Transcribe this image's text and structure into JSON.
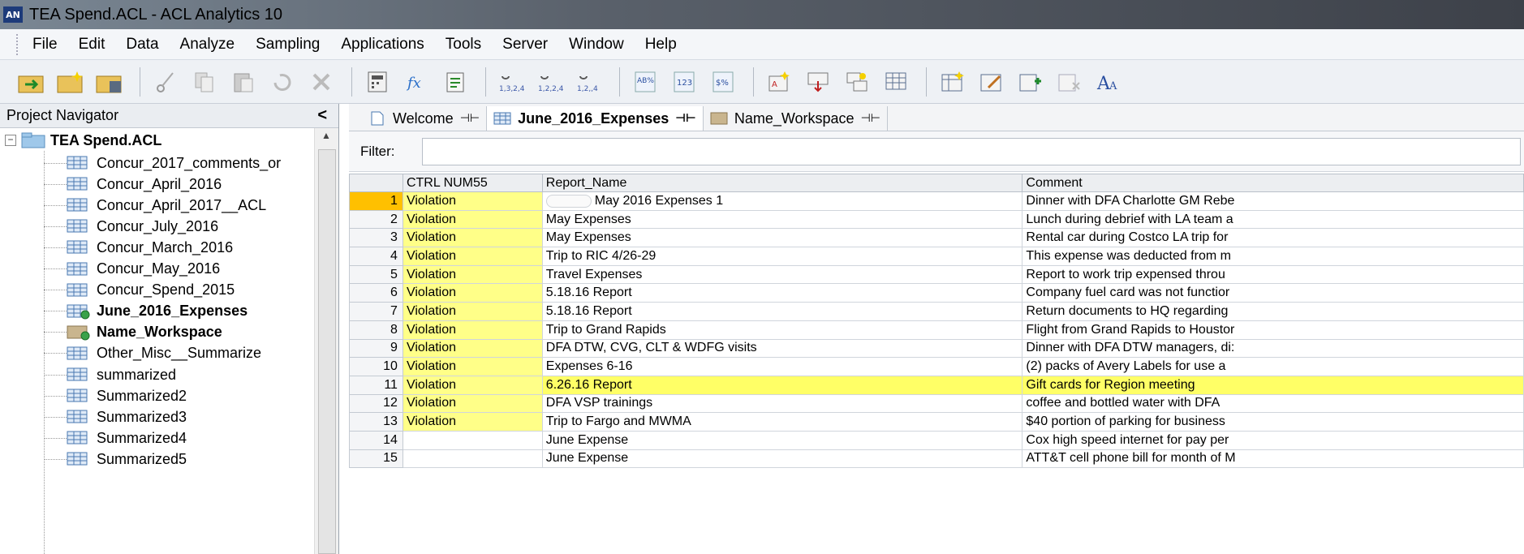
{
  "window": {
    "title": "TEA Spend.ACL - ACL Analytics 10",
    "logo": "AN"
  },
  "menu": [
    "File",
    "Edit",
    "Data",
    "Analyze",
    "Sampling",
    "Applications",
    "Tools",
    "Server",
    "Window",
    "Help"
  ],
  "toolbar_icons": [
    "open-project-icon",
    "new-project-icon",
    "save-project-icon",
    "cut-icon",
    "copy-icon",
    "paste-icon",
    "undo-icon",
    "delete-icon",
    "calculator-icon",
    "function-icon",
    "clipboard-icon",
    "sort-ascending-icon",
    "sort-quick-icon",
    "sort-descending-icon",
    "format-icon",
    "number-format-icon",
    "currency-format-icon",
    "add-field-icon",
    "filter-table-icon",
    "relation-icon",
    "table-layout-icon",
    "add-table-icon",
    "edit-table-icon",
    "add-column-icon",
    "remove-column-icon",
    "font-icon"
  ],
  "navigator": {
    "title": "Project Navigator",
    "collapse_glyph": "<",
    "root": {
      "expander": "−",
      "label": "TEA Spend.ACL"
    },
    "items": [
      {
        "label": "Concur_2017_comments_or",
        "bold": false,
        "type": "table"
      },
      {
        "label": "Concur_April_2016",
        "bold": false,
        "type": "table"
      },
      {
        "label": "Concur_April_2017__ACL",
        "bold": false,
        "type": "table"
      },
      {
        "label": "Concur_July_2016",
        "bold": false,
        "type": "table"
      },
      {
        "label": "Concur_March_2016",
        "bold": false,
        "type": "table"
      },
      {
        "label": "Concur_May_2016",
        "bold": false,
        "type": "table"
      },
      {
        "label": "Concur_Spend_2015",
        "bold": false,
        "type": "table"
      },
      {
        "label": "June_2016_Expenses",
        "bold": true,
        "type": "table-open"
      },
      {
        "label": "Name_Workspace",
        "bold": true,
        "type": "workspace-open"
      },
      {
        "label": "Other_Misc__Summarize",
        "bold": false,
        "type": "table"
      },
      {
        "label": "summarized",
        "bold": false,
        "type": "table"
      },
      {
        "label": "Summarized2",
        "bold": false,
        "type": "table"
      },
      {
        "label": "Summarized3",
        "bold": false,
        "type": "table"
      },
      {
        "label": "Summarized4",
        "bold": false,
        "type": "table"
      },
      {
        "label": "Summarized5",
        "bold": false,
        "type": "table"
      }
    ]
  },
  "tabs": [
    {
      "label": "Welcome",
      "icon": "page-icon",
      "active": false
    },
    {
      "label": "June_2016_Expenses",
      "icon": "table-icon",
      "active": true
    },
    {
      "label": "Name_Workspace",
      "icon": "workspace-icon",
      "active": false
    }
  ],
  "filter": {
    "label": "Filter:",
    "value": ""
  },
  "grid": {
    "columns": [
      "CTRL NUM55",
      "Report_Name",
      "Comment"
    ],
    "selected_row": 1,
    "highlight_color": "#ffff88",
    "rows": [
      {
        "n": "1",
        "ctrl": "Violation",
        "report": "May 2016 Expenses 1",
        "comment": "Dinner with DFA Charlotte GM Rebe",
        "redacted": true
      },
      {
        "n": "2",
        "ctrl": "Violation",
        "report": "May Expenses",
        "comment": "Lunch during debrief with LA team a"
      },
      {
        "n": "3",
        "ctrl": "Violation",
        "report": "May Expenses",
        "comment": "Rental car during Costco LA trip for"
      },
      {
        "n": "4",
        "ctrl": "Violation",
        "report": "Trip to RIC 4/26-29",
        "comment": "This expense was deducted from m"
      },
      {
        "n": "5",
        "ctrl": "Violation",
        "report": "Travel Expenses",
        "comment": "Report to work trip expensed throu"
      },
      {
        "n": "6",
        "ctrl": "Violation",
        "report": "5.18.16 Report",
        "comment": "Company fuel card was not functior"
      },
      {
        "n": "7",
        "ctrl": "Violation",
        "report": "5.18.16 Report",
        "comment": "Return documents to HQ regarding"
      },
      {
        "n": "8",
        "ctrl": "Violation",
        "report": "Trip to Grand Rapids",
        "comment": "Flight from Grand Rapids to Houstor"
      },
      {
        "n": "9",
        "ctrl": "Violation",
        "report": "DFA DTW, CVG, CLT & WDFG visits",
        "comment": "Dinner with DFA DTW managers, di:"
      },
      {
        "n": "10",
        "ctrl": "Violation",
        "report": "Expenses 6-16",
        "comment": "(2) packs of Avery Labels for use a"
      },
      {
        "n": "11",
        "ctrl": "Violation",
        "report": "6.26.16 Report",
        "comment": "Gift cards for Region meeting",
        "highlight_row": true
      },
      {
        "n": "12",
        "ctrl": "Violation",
        "report": "DFA VSP trainings",
        "comment": "coffee and bottled water with DFA"
      },
      {
        "n": "13",
        "ctrl": "Violation",
        "report": "Trip to Fargo and MWMA",
        "comment": "$40 portion of parking for business"
      },
      {
        "n": "14",
        "ctrl": "",
        "report": "June Expense",
        "comment": "Cox high speed internet for pay per"
      },
      {
        "n": "15",
        "ctrl": "",
        "report": "June Expense",
        "comment": "ATT&T cell phone bill for month of M"
      }
    ]
  }
}
